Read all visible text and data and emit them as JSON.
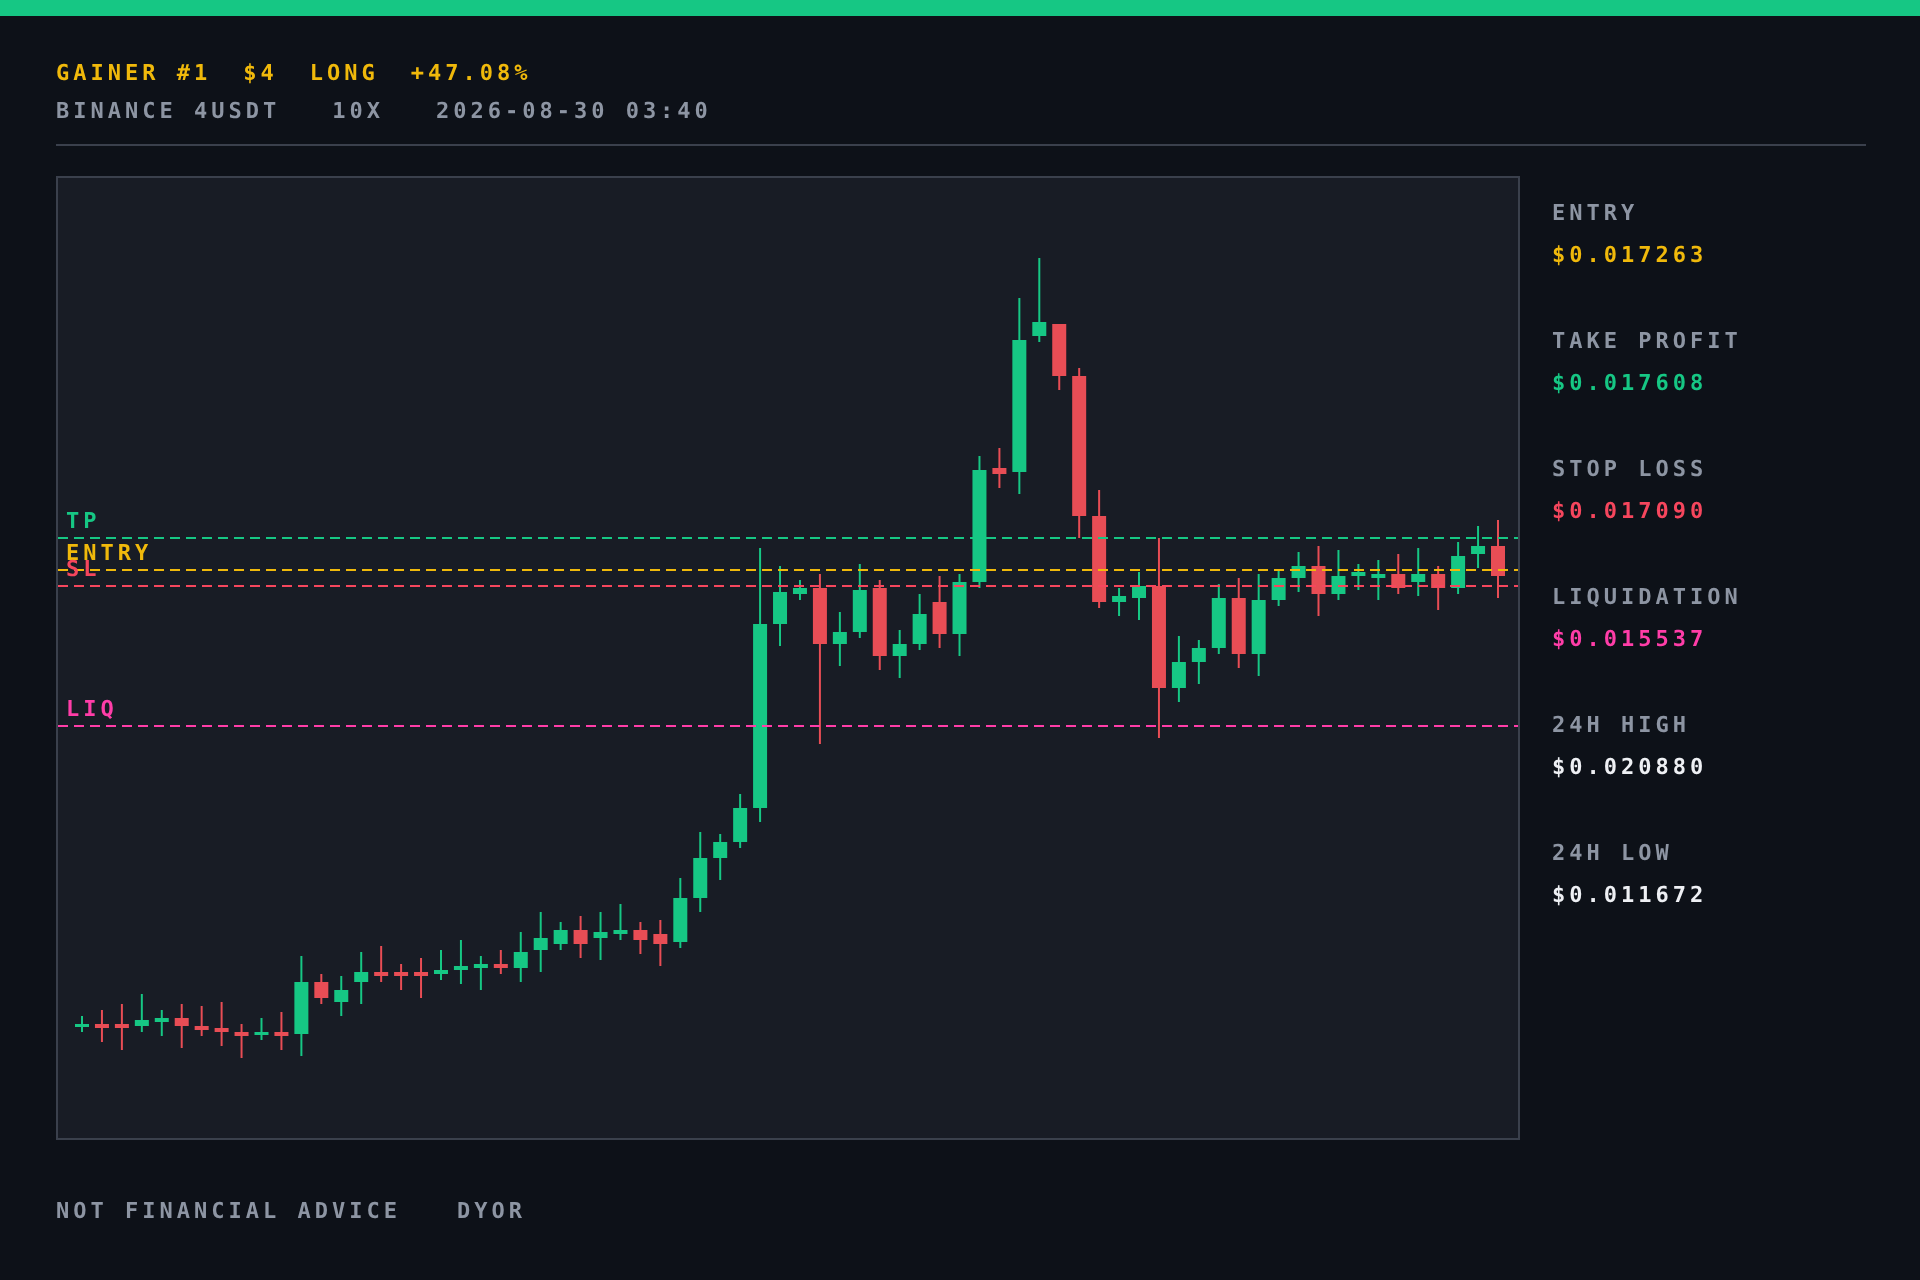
{
  "header": {
    "title": [
      "GAINER #1",
      "$4",
      "LONG",
      "+47.08%"
    ],
    "subtitle": [
      "BINANCE 4USDT",
      "10X",
      "2026-08-30 03:40"
    ]
  },
  "chart": {
    "levels": [
      {
        "label": "TP",
        "color": "#16c784"
      },
      {
        "label": "ENTRY",
        "color": "#f0b90b"
      },
      {
        "label": "SL",
        "color": "#f6465d"
      },
      {
        "label": "LIQ",
        "color": "#ff3da8"
      }
    ]
  },
  "sidebar": {
    "stats": [
      {
        "label": "ENTRY",
        "value": "$0.017263",
        "color": "#f0b90b"
      },
      {
        "label": "TAKE PROFIT",
        "value": "$0.017608",
        "color": "#16c784"
      },
      {
        "label": "STOP LOSS",
        "value": "$0.017090",
        "color": "#f6465d"
      },
      {
        "label": "LIQUIDATION",
        "value": "$0.015537",
        "color": "#ff3da8"
      },
      {
        "label": "24H HIGH",
        "value": "$0.020880",
        "color": "#eef0f4"
      },
      {
        "label": "24H LOW",
        "value": "$0.011672",
        "color": "#eef0f4"
      }
    ]
  },
  "footer": [
    "NOT FINANCIAL ADVICE",
    "DYOR"
  ]
}
